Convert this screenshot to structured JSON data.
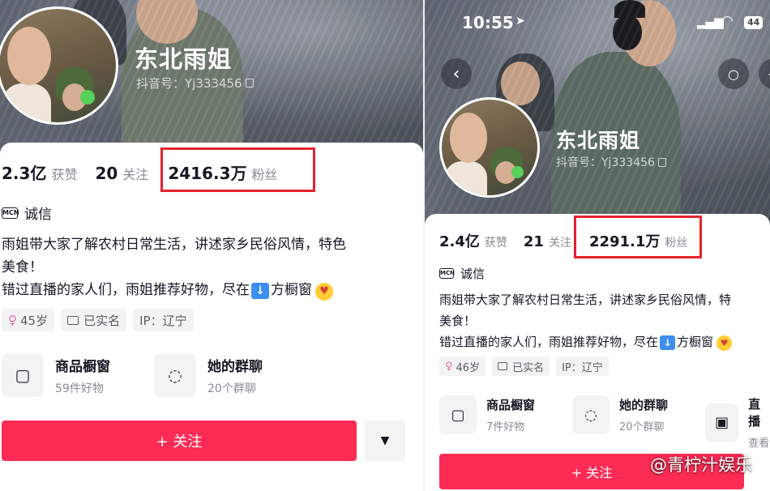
{
  "left": {
    "profile_name": "东北雨姐",
    "douyin_id": "抖音号：Yj333456",
    "likes_value": "2.3亿",
    "likes_label": "获赞",
    "following_value": "20",
    "following_label": "关注",
    "fans_value": "2416.3万",
    "fans_label": "粉丝",
    "mcn_badge": "MCN",
    "credit_label": "诚信",
    "bio_line1": "雨姐带大家了解农村日常生活，讲述家乡民俗风情，特色",
    "bio_line2": "美食！",
    "bio_line3_pre": "错过直播的家人们，雨姐推荐好物，尽在",
    "bio_line3_post": "方橱窗",
    "tag_age": "45岁",
    "tag_verified": "已实名",
    "tag_ip": "IP：辽宁",
    "shop_title": "商品橱窗",
    "shop_sub": "59件好物",
    "group_title": "她的群聊",
    "group_sub": "20个群聊",
    "follow_label": "+ 关注"
  },
  "right": {
    "time": "10:55",
    "battery": "44",
    "profile_name": "东北雨姐",
    "douyin_id": "抖音号：Yj333456",
    "likes_value": "2.4亿",
    "likes_label": "获赞",
    "following_value": "21",
    "following_label": "关注",
    "fans_value": "2291.1万",
    "fans_label": "粉丝",
    "mcn_badge": "MCN",
    "credit_label": "诚信",
    "bio_line1": "雨姐带大家了解农村日常生活，讲述家乡民俗风情，特",
    "bio_line2": "美食！",
    "bio_line3_pre": "错过直播的家人们，雨姐推荐好物，尽在",
    "bio_line3_post": "方橱窗",
    "tag_age": "46岁",
    "tag_verified": "已实名",
    "tag_ip": "IP：辽宁",
    "shop_title": "商品橱窗",
    "shop_sub": "7件好物",
    "group_title": "她的群聊",
    "group_sub": "20个群聊",
    "live_title": "直播",
    "live_sub": "查看",
    "follow_label": "+ 关注"
  },
  "watermark": "@青柠汁娱乐",
  "highlight_color": "#e5232f",
  "accent_color": "#fe2c55"
}
